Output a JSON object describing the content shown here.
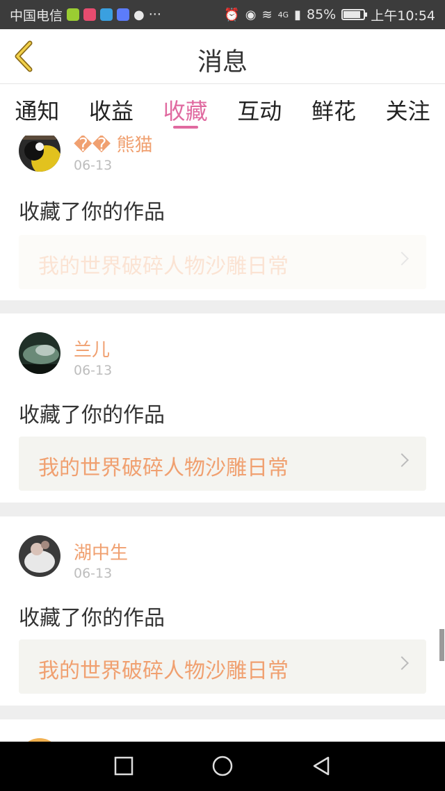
{
  "status_bar": {
    "carrier": "中国电信",
    "more": "···",
    "network": "4G",
    "battery_text": "85%",
    "battery_level": 0.85,
    "time": "上午10:54"
  },
  "header": {
    "title": "消息",
    "back_icon": "back-chevron-icon"
  },
  "tabs": [
    {
      "label": "通知",
      "active": false
    },
    {
      "label": "收益",
      "active": false
    },
    {
      "label": "收藏",
      "active": true
    },
    {
      "label": "互动",
      "active": false
    },
    {
      "label": "鲜花",
      "active": false
    },
    {
      "label": "关注",
      "active": false
    }
  ],
  "feed": [
    {
      "username": "�� 熊猫",
      "date": "06-13",
      "action": "收藏了你的作品",
      "work_title": "我的世界破碎人物沙雕日常"
    },
    {
      "username": "兰儿",
      "date": "06-13",
      "action": "收藏了你的作品",
      "work_title": "我的世界破碎人物沙雕日常"
    },
    {
      "username": "湖中生",
      "date": "06-13",
      "action": "收藏了你的作品",
      "work_title": "我的世界破碎人物沙雕日常"
    }
  ],
  "colors": {
    "accent": "#e06aa0",
    "username": "#f0a070",
    "status_bar_bg": "#3c3c3c"
  },
  "nav_bar": {
    "icons": [
      "recent-apps-icon",
      "home-icon",
      "back-triangle-icon"
    ]
  }
}
